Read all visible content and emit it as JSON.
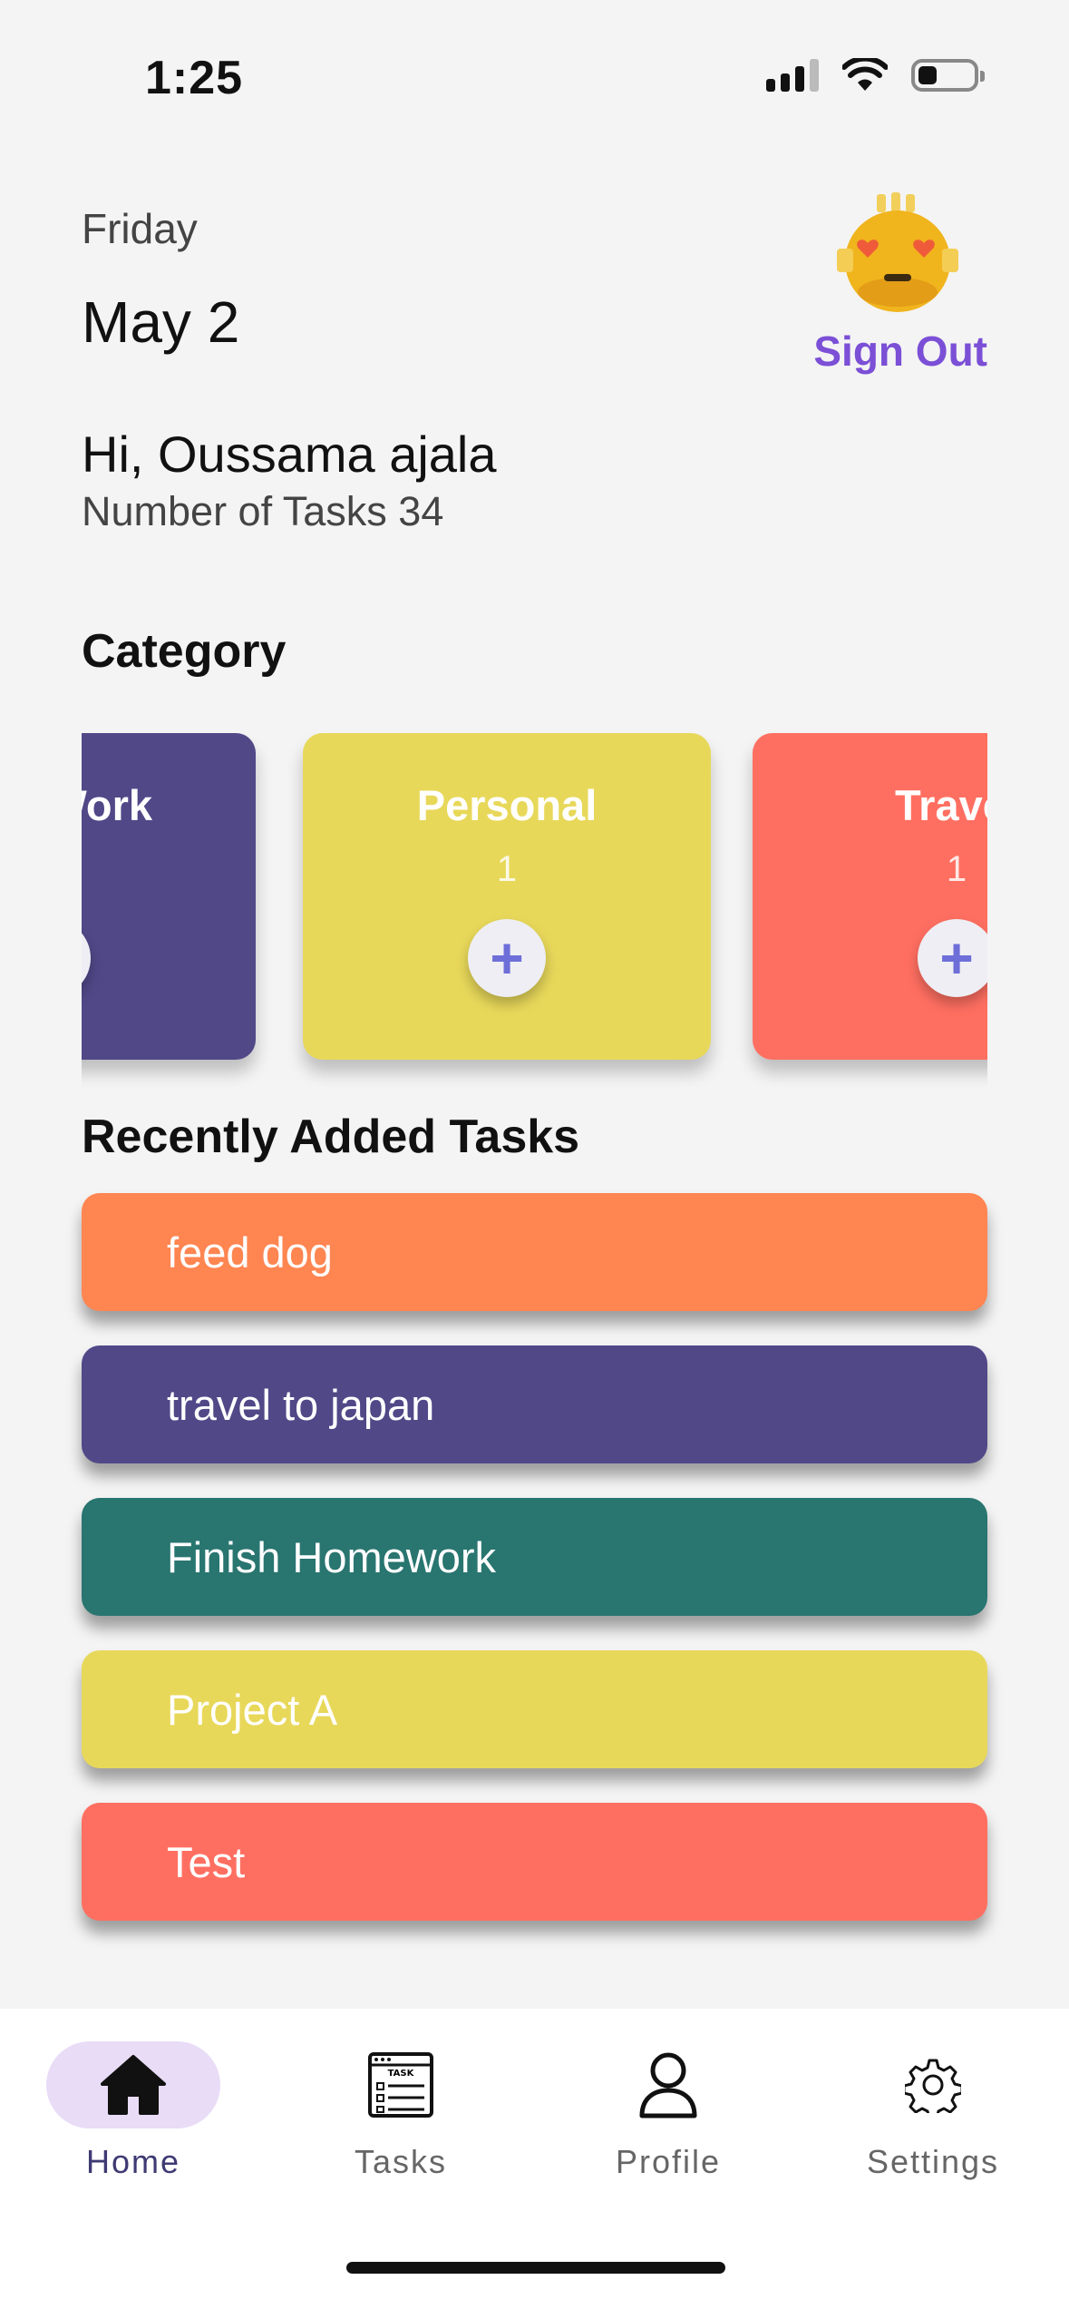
{
  "status_bar": {
    "time": "1:25"
  },
  "header": {
    "day": "Friday",
    "date": "May 2",
    "sign_out": "Sign Out",
    "greeting": "Hi, Oussama ajala",
    "task_count": "Number of Tasks 34"
  },
  "category": {
    "title": "Category",
    "cards": [
      {
        "name": "Work",
        "count": "",
        "color": "#514888"
      },
      {
        "name": "Personal",
        "count": "1",
        "color": "#e8d85a"
      },
      {
        "name": "Travel",
        "count": "1",
        "color": "#ff6f61"
      }
    ]
  },
  "recent": {
    "title": "Recently Added Tasks",
    "tasks": [
      {
        "name": "feed dog",
        "color": "#ff8551"
      },
      {
        "name": "travel to japan",
        "color": "#514888"
      },
      {
        "name": "Finish Homework",
        "color": "#297570"
      },
      {
        "name": "Project A",
        "color": "#e8d85a"
      },
      {
        "name": "Test",
        "color": "#ff6f61"
      }
    ]
  },
  "nav": {
    "items": [
      {
        "label": "Home",
        "icon": "home-icon",
        "active": true
      },
      {
        "label": "Tasks",
        "icon": "task-list-icon",
        "active": false
      },
      {
        "label": "Profile",
        "icon": "profile-icon",
        "active": false
      },
      {
        "label": "Settings",
        "icon": "gear-icon",
        "active": false
      }
    ]
  },
  "colors": {
    "accent": "#7b4fd6",
    "nav_active_bg": "#e9dcf7",
    "background": "#f4f4f4"
  }
}
